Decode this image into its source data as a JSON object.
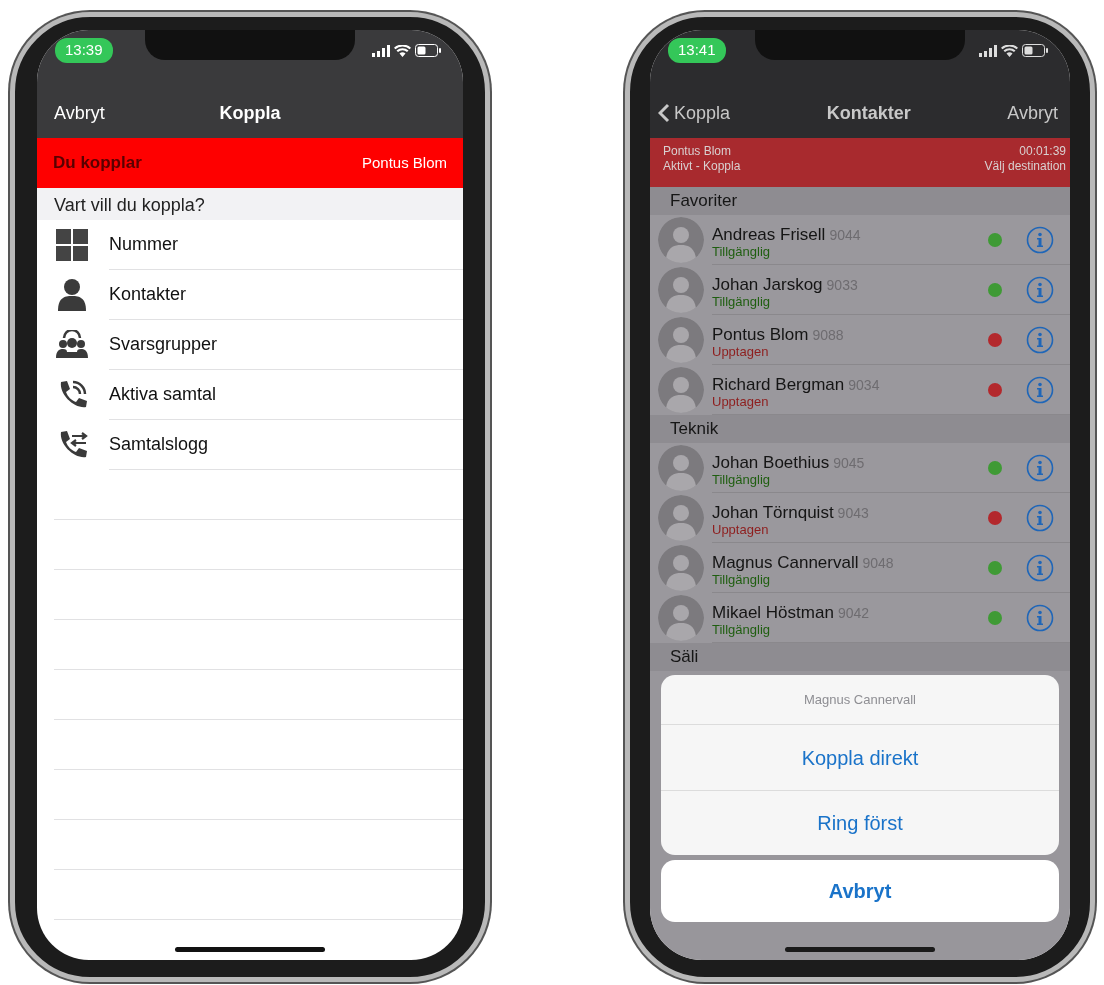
{
  "phones": [
    {
      "kind": "transfer_menu",
      "status_time": "13:39",
      "nav": {
        "left": "Avbryt",
        "title": "Koppla"
      },
      "banner": {
        "label": "Du kopplar",
        "name": "Pontus Blom"
      },
      "section": "Vart vill du koppla?",
      "items": [
        {
          "kind": "keypad",
          "label": "Nummer"
        },
        {
          "kind": "person",
          "label": "Kontakter"
        },
        {
          "kind": "group",
          "label": "Svarsgrupper"
        },
        {
          "kind": "active_call",
          "label": "Aktiva samtal"
        },
        {
          "kind": "call_log",
          "label": "Samtalslogg"
        }
      ]
    },
    {
      "kind": "contacts",
      "status_time": "13:41",
      "nav": {
        "back": "Koppla",
        "title": "Kontakter",
        "right": "Avbryt"
      },
      "call_banner": {
        "caller": "Pontus Blom",
        "state": "Aktivt - Koppla",
        "timer": "00:01:39",
        "hint": "Välj destination"
      },
      "groups": [
        {
          "title": "Favoriter",
          "contacts": [
            {
              "name": "Andreas Frisell",
              "ext": "9044",
              "status": "Tillgänglig",
              "available": true
            },
            {
              "name": "Johan Jarskog",
              "ext": "9033",
              "status": "Tillgänglig",
              "available": true
            },
            {
              "name": "Pontus Blom",
              "ext": "9088",
              "status": "Upptagen",
              "available": false
            },
            {
              "name": "Richard Bergman",
              "ext": "9034",
              "status": "Upptagen",
              "available": false
            }
          ]
        },
        {
          "title": "Teknik",
          "contacts": [
            {
              "name": "Johan Boethius",
              "ext": "9045",
              "status": "Tillgänglig",
              "available": true
            },
            {
              "name": "Johan Törnquist",
              "ext": "9043",
              "status": "Upptagen",
              "available": false
            },
            {
              "name": "Magnus Cannervall",
              "ext": "9048",
              "status": "Tillgänglig",
              "available": true
            },
            {
              "name": "Mikael Höstman",
              "ext": "9042",
              "status": "Tillgänglig",
              "available": true
            }
          ]
        },
        {
          "title": "Säli"
        }
      ],
      "action_sheet": {
        "title": "Magnus Cannervall",
        "actions": [
          "Koppla direkt",
          "Ring först"
        ],
        "cancel": "Avbryt"
      }
    }
  ]
}
